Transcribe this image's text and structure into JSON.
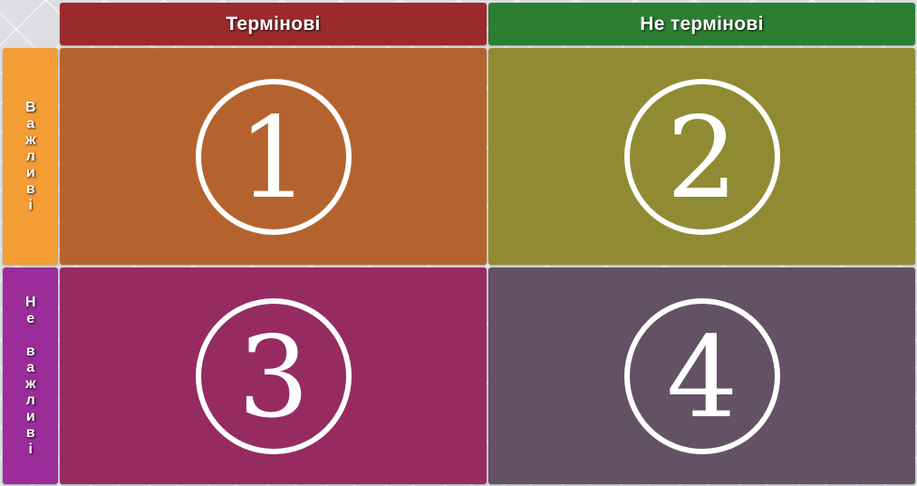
{
  "columns": {
    "urgent": "Термінові",
    "not_urgent": "Не термінові"
  },
  "rows": {
    "important": "Важливі",
    "not_important": "Не важливі"
  },
  "quadrants": [
    {
      "number": "1",
      "color": "#b5632e"
    },
    {
      "number": "2",
      "color": "#908b32"
    },
    {
      "number": "3",
      "color": "#962b62"
    },
    {
      "number": "4",
      "color": "#625264"
    }
  ],
  "colors": {
    "urgent_header": "#9a2a2c",
    "not_urgent_header": "#2b7e32",
    "important_label": "#f59d35",
    "not_important_label": "#9a2d9a"
  }
}
